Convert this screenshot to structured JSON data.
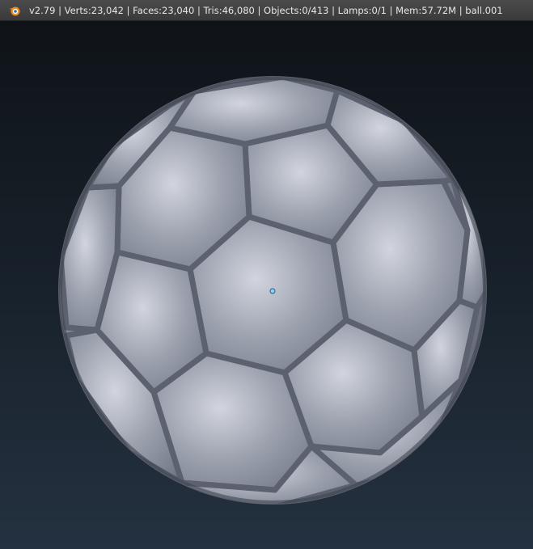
{
  "header": {
    "logo_icon": "blender-logo-icon",
    "stats_text": "v2.79 | Verts:23,042 | Faces:23,040 | Tris:46,080 | Objects:0/413 | Lamps:0/1 | Mem:57.72M | ball.001"
  },
  "viewport": {
    "object_name": "ball.001",
    "object_type": "soccer-ball-mesh",
    "origin_marker_color": "#7fd4ff",
    "background_top": "#0f1318",
    "background_bottom": "#243140",
    "mesh_color": "#8a8f9c"
  }
}
